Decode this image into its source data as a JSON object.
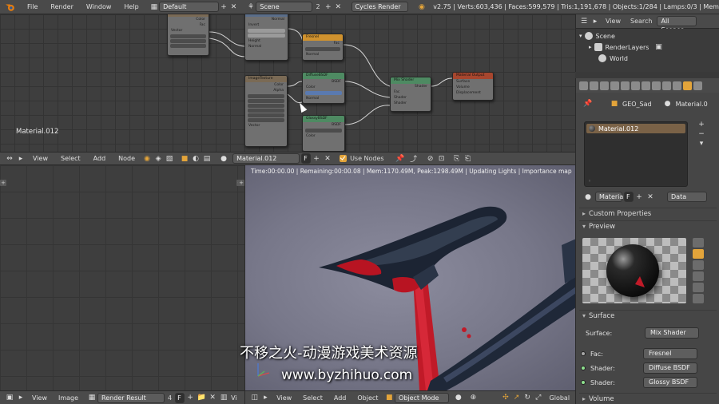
{
  "topbar": {
    "menus": [
      "File",
      "Render",
      "Window",
      "Help"
    ],
    "layout": "Default",
    "scene": "Scene",
    "scene_users": "2",
    "engine": "Cycles Render",
    "stats": "v2.75 | Verts:603,436 | Faces:599,579 | Tris:1,191,678 | Objects:1/284 | Lamps:0/3 | Mem"
  },
  "node_editor": {
    "material_label": "Material.012",
    "header_menus": [
      "View",
      "Select",
      "Add",
      "Node"
    ],
    "material_field": "Material.012",
    "fake_user": "F",
    "use_nodes_label": "Use Nodes"
  },
  "render_status": "Time:00:00.00 | Remaining:00:00.08 | Mem:1170.49M, Peak:1298.49M | Updating Lights | Importance map",
  "image_editor_header": {
    "menus": [
      "View",
      "Image"
    ],
    "image_name": "Render Result",
    "users": "4",
    "fake_user": "F",
    "trailing_menu": "Vi"
  },
  "view3d_header": {
    "menus": [
      "View",
      "Select",
      "Add",
      "Object"
    ],
    "mode": "Object Mode",
    "orientation": "Global"
  },
  "outliner": {
    "header_menus": [
      "View",
      "Search",
      "All Scenes"
    ],
    "items": [
      "Scene",
      "RenderLayers",
      "World"
    ]
  },
  "properties": {
    "object_name": "GEO_Sad",
    "material_crumb": "Material.0",
    "slot_name": "Material.012",
    "datablock_name": "Materia",
    "datablock_fake": "F",
    "link_type": "Data",
    "panels": {
      "custom_properties": "Custom Properties",
      "preview": "Preview",
      "surface": "Surface",
      "volume": "Volume"
    },
    "surface_rows": [
      {
        "label": "Surface:",
        "value": "Mix Shader"
      },
      {
        "label": "Fac:",
        "value": "Fresnel"
      },
      {
        "label": "Shader:",
        "value": "Diffuse BSDF"
      },
      {
        "label": "Shader:",
        "value": "Glossy BSDF"
      }
    ]
  },
  "watermark": {
    "line1": "不移之火-动漫游戏美术资源",
    "line2": "www.byzhihuo.com"
  },
  "colors": {
    "accent": "#e3a43a",
    "panel": "#464646",
    "header": "#4a4a4a",
    "node_grid": "#3e3e3e"
  }
}
